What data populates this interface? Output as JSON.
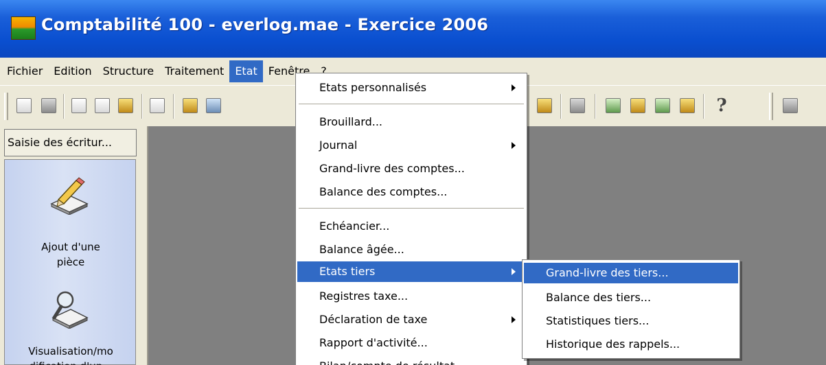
{
  "window": {
    "title": "Comptabilité 100 - everlog.mae - Exercice 2006",
    "icon": "app-icon"
  },
  "menubar": {
    "items": [
      {
        "label": "Fichier"
      },
      {
        "label": "Edition"
      },
      {
        "label": "Structure"
      },
      {
        "label": "Traitement"
      },
      {
        "label": "Etat"
      },
      {
        "label": "Fenêtre"
      },
      {
        "label": "?"
      }
    ],
    "active": "Etat"
  },
  "toolbar": {
    "help_glyph": "?"
  },
  "left_pane": {
    "header": "Saisie des écritur...",
    "items": [
      {
        "label_line1": "Ajout d'une",
        "label_line2": "pièce",
        "icon": "pencil-ledger-icon"
      },
      {
        "label_line1": "Visualisation/mo",
        "label_line2": "dification d'un...",
        "icon": "magnifier-ledger-icon"
      }
    ]
  },
  "etat_menu": {
    "items": [
      {
        "label": "Etats personnalisés",
        "submenu": true
      },
      {
        "label": "Brouillard..."
      },
      {
        "label": "Journal",
        "submenu": true
      },
      {
        "label": "Grand-livre des comptes..."
      },
      {
        "label": "Balance des comptes..."
      },
      {
        "label": "Echéancier..."
      },
      {
        "label": "Balance âgée..."
      },
      {
        "label": "Etats tiers",
        "submenu": true,
        "highlighted": true
      },
      {
        "label": "Registres taxe..."
      },
      {
        "label": "Déclaration de taxe",
        "submenu": true
      },
      {
        "label": "Rapport d'activité..."
      },
      {
        "label": "Bilan/compte de résultat..."
      }
    ]
  },
  "etats_tiers_submenu": {
    "items": [
      {
        "label": "Grand-livre des tiers...",
        "highlighted": true
      },
      {
        "label": "Balance des tiers..."
      },
      {
        "label": "Statistiques tiers..."
      },
      {
        "label": "Historique des rappels..."
      }
    ]
  },
  "colors": {
    "titlebar": "#0a4fd0",
    "highlight": "#316ac5",
    "workspace": "#808080",
    "chrome": "#ece9d8"
  }
}
